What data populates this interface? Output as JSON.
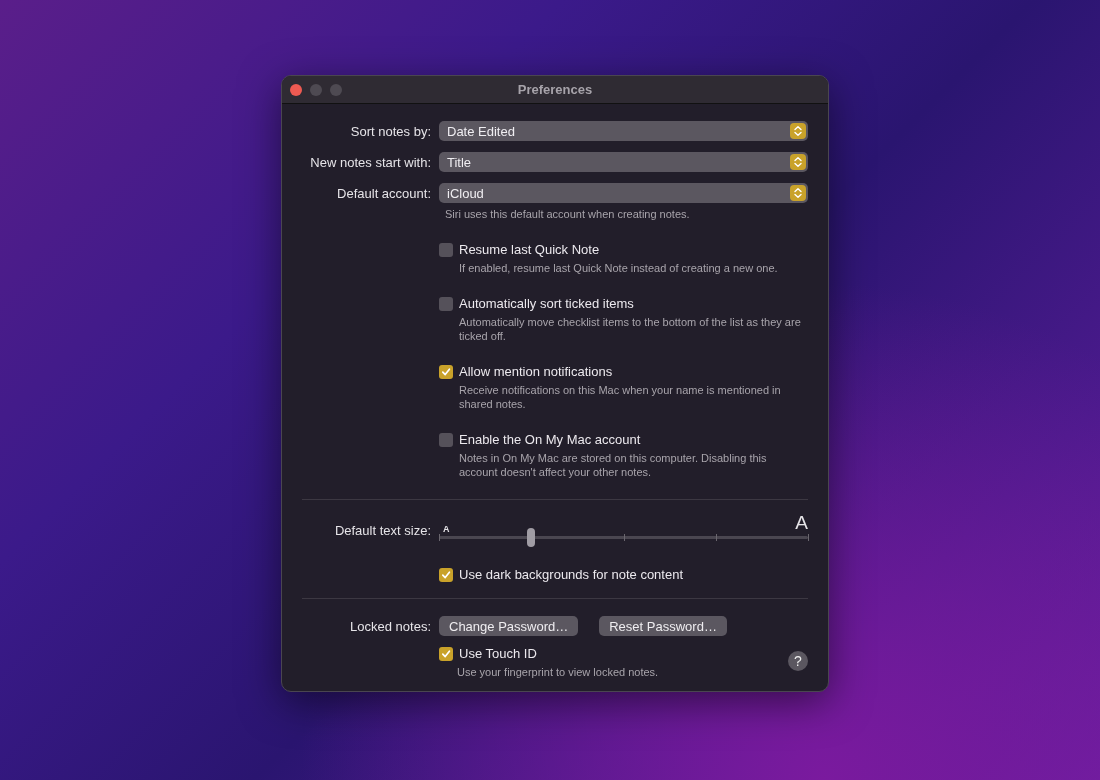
{
  "window": {
    "title": "Preferences"
  },
  "popups": [
    {
      "label": "Sort notes by:",
      "value": "Date Edited"
    },
    {
      "label": "New notes start with:",
      "value": "Title"
    },
    {
      "label": "Default account:",
      "value": "iCloud"
    }
  ],
  "default_account_note": "Siri uses this default account when creating notes.",
  "options": [
    {
      "label": "Resume last Quick Note",
      "description": "If enabled, resume last Quick Note instead of creating a new one.",
      "checked": false
    },
    {
      "label": "Automatically sort ticked items",
      "description": "Automatically move checklist items to the bottom of the list as they are ticked off.",
      "checked": false
    },
    {
      "label": "Allow mention notifications",
      "description": "Receive notifications on this Mac when your name is mentioned in shared notes.",
      "checked": true
    },
    {
      "label": "Enable the On My Mac account",
      "description": "Notes in On My Mac are stored on this computer. Disabling this account doesn't affect your other notes.",
      "checked": false
    }
  ],
  "text_size": {
    "label": "Default text size:",
    "small_glyph": "A",
    "large_glyph": "A",
    "level": 0.25
  },
  "dark_backgrounds": {
    "label": "Use dark backgrounds for note content",
    "checked": true
  },
  "locked_notes": {
    "label": "Locked notes:",
    "buttons": [
      "Change Password…",
      "Reset Password…"
    ],
    "touch_id": {
      "label": "Use Touch ID",
      "checked": true,
      "description": "Use your fingerprint to view locked notes."
    }
  },
  "help": "?"
}
